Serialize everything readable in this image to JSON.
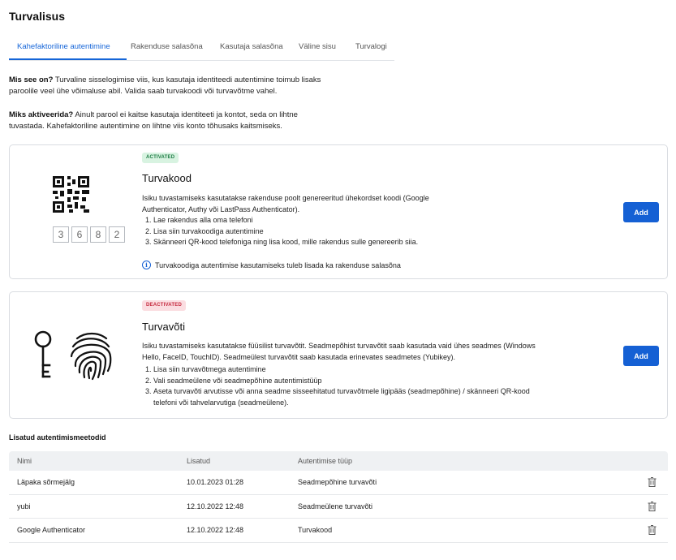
{
  "page": {
    "title": "Turvalisus"
  },
  "tabs": [
    {
      "label": "Kahefaktoriline autentimine",
      "active": true
    },
    {
      "label": "Rakenduse salasõna",
      "active": false
    },
    {
      "label": "Kasutaja salasõna",
      "active": false
    },
    {
      "label": "Väline sisu",
      "active": false
    },
    {
      "label": "Turvalogi",
      "active": false
    }
  ],
  "intro": {
    "what_label": "Mis see on?",
    "what_text": " Turvaline sisselogimise viis, kus kasutaja identiteedi autentimine toimub lisaks paroolile veel ühe võimaluse abil. Valida saab turvakoodi või turvavõtme vahel.",
    "why_label": "Miks aktiveerida?",
    "why_text": " Ainult parool ei kaitse kasutaja identiteeti ja kontot, seda on lihtne tuvastada. Kahefaktoriline autentimine on lihtne viis konto tõhusaks kaitsmiseks."
  },
  "cards": {
    "code": {
      "status": "ACTIVATED",
      "title": "Turvakood",
      "desc": "Isiku tuvastamiseks kasutatakse rakenduse poolt genereeritud ühekordset koodi (Google Authenticator, Authy või LastPass Authenticator).",
      "steps": [
        {
          "num": "1.",
          "text": "Lae rakendus alla oma telefoni"
        },
        {
          "num": "2.",
          "text": "Lisa siin turvakoodiga autentimine"
        },
        {
          "num": "3.",
          "text": "Skänneeri QR-kood telefoniga ning lisa kood, mille rakendus sulle genereerib siia."
        }
      ],
      "info": "Turvakoodiga autentimise kasutamiseks tuleb lisada ka rakenduse salasõna",
      "add_label": "Add",
      "digits": [
        "3",
        "6",
        "8",
        "2"
      ]
    },
    "key": {
      "status": "DEACTIVATED",
      "title": "Turvavõti",
      "desc": "Isiku tuvastamiseks kasutatakse füüsilist turvavõtit. Seadmepõhist turvavõtit saab kasutada vaid ühes seadmes (Windows Hello, FaceID, TouchID). Seadmeülest turvavõtit saab kasutada erinevates seadmetes (Yubikey).",
      "steps": [
        {
          "num": "1.",
          "text": "Lisa siin turvavõtmega autentimine"
        },
        {
          "num": "2.",
          "text": "Vali seadmeülene või seadmepõhine autentimistüüp"
        },
        {
          "num": "3.",
          "text": "Aseta turvavõti arvutisse või anna seadme sisseehitatud turvavõtmele ligipääs (seadmepõhine) / skänneeri QR-kood telefoni või tahvelarvutiga (seadmeülene)."
        }
      ],
      "add_label": "Add"
    }
  },
  "methods": {
    "section_title": "Lisatud autentimismeetodid",
    "columns": [
      "Nimi",
      "Lisatud",
      "Autentimise tüüp"
    ],
    "rows": [
      {
        "name": "Läpaka sõrmejälg",
        "added": "10.01.2023 01:28",
        "type": "Seadmepõhine turvavõti"
      },
      {
        "name": "yubi",
        "added": "12.10.2022 12:48",
        "type": "Seadmeülene turvavõti"
      },
      {
        "name": "Google Authenticator",
        "added": "12.10.2022 12:48",
        "type": "Turvakood"
      }
    ]
  },
  "colors": {
    "accent": "#1560d4",
    "activated_bg": "#d8f3e1",
    "deactivated_bg": "#fbdde1"
  }
}
